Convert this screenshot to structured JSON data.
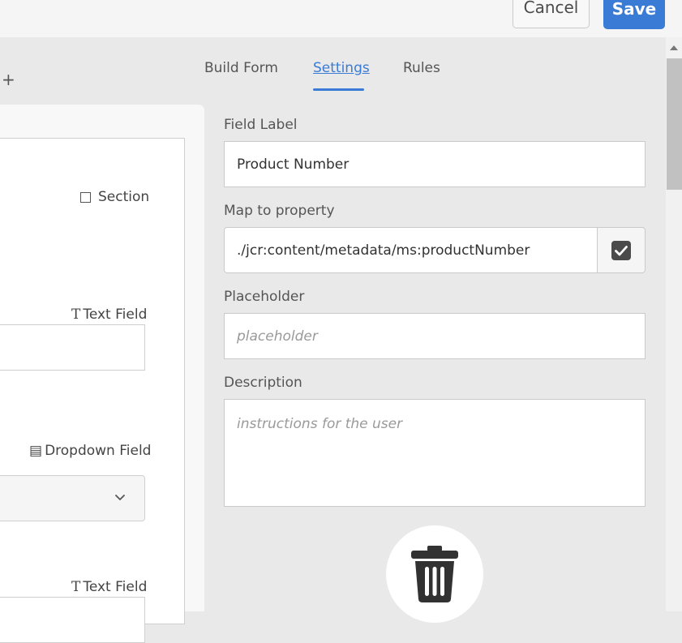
{
  "toolbar": {
    "cancel_label": "Cancel",
    "save_label": "Save"
  },
  "canvas": {
    "add_symbol": "+",
    "components": [
      {
        "label": "Section"
      },
      {
        "icon_glyph": "T",
        "label": "Text Field"
      },
      {
        "icon_glyph": "▤",
        "label": "Dropdown Field"
      },
      {
        "icon_glyph": "T",
        "label": "Text Field"
      }
    ]
  },
  "tabs": [
    {
      "label": "Build Form",
      "active": false
    },
    {
      "label": "Settings",
      "active": true
    },
    {
      "label": "Rules",
      "active": false
    }
  ],
  "settings": {
    "field_label": {
      "label": "Field Label",
      "value": "Product Number"
    },
    "map_to_property": {
      "label": "Map to property",
      "value": "./jcr:content/metadata/ms:productNumber",
      "checked": true
    },
    "placeholder": {
      "label": "Placeholder",
      "placeholder": "placeholder"
    },
    "description": {
      "label": "Description",
      "placeholder": "instructions for the user"
    }
  },
  "icons": {
    "delete": "trash-icon",
    "check": "checkbox-checked-icon",
    "expand": "chevron-down-icon"
  },
  "colors": {
    "accent": "#3a7bd5",
    "panel_bg": "#e9e9e9",
    "icon_dark": "#323232"
  }
}
